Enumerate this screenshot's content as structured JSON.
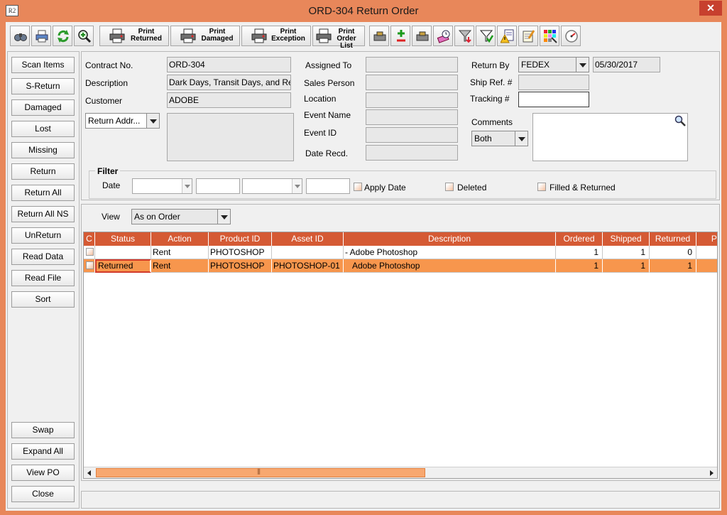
{
  "window": {
    "title": "ORD-304 Return Order",
    "app_icon_label": "R2",
    "close_symbol": "✕",
    "accent_color": "#e8875a"
  },
  "toolbar": {
    "print_returned": [
      "Print",
      "Returned"
    ],
    "print_damaged": [
      "Print",
      "Damaged"
    ],
    "print_exception": [
      "Print",
      "Exception"
    ],
    "print_order_list": [
      "Print",
      "Order List"
    ]
  },
  "left_buttons": {
    "scan_items": "Scan Items",
    "s_return": "S-Return",
    "damaged": "Damaged",
    "lost": "Lost",
    "missing": "Missing",
    "return": "Return",
    "return_all": "Return All",
    "return_all_ns": "Return All NS",
    "unreturn": "UnReturn",
    "read_data": "Read Data",
    "read_file": "Read File",
    "sort": "Sort",
    "swap": "Swap",
    "expand_all": "Expand All",
    "view_po": "View PO",
    "close": "Close"
  },
  "header": {
    "contract_no_label": "Contract No.",
    "contract_no": "ORD-304",
    "description_label": "Description",
    "description": "Dark Days, Transit Days, and Re",
    "customer_label": "Customer",
    "customer": "ADOBE",
    "address_select": "Return Addr...",
    "assigned_to_label": "Assigned To",
    "sales_person_label": "Sales Person",
    "location_label": "Location",
    "event_name_label": "Event Name",
    "event_id_label": "Event ID",
    "date_recd_label": "Date Recd.",
    "return_by_label": "Return By",
    "return_by": "FEDEX",
    "return_date": "05/30/2017",
    "ship_ref_label": "Ship Ref. #",
    "tracking_label": "Tracking #",
    "comments_label": "Comments",
    "comments_select": "Both"
  },
  "filter": {
    "title": "Filter",
    "date_label": "Date",
    "apply_date": "Apply Date",
    "deleted": "Deleted",
    "filled_returned": "Filled & Returned"
  },
  "view": {
    "label": "View",
    "selected": "As on Order"
  },
  "grid": {
    "columns": [
      "C",
      "Status",
      "Action",
      "Product ID",
      "Asset ID",
      "Description",
      "Ordered",
      "Shipped",
      "Returned",
      "PO"
    ],
    "rows": [
      {
        "status": "",
        "action": "Rent",
        "product_id": "PHOTOSHOP",
        "asset_id": "",
        "description": "- Adobe Photoshop",
        "ordered": "1",
        "shipped": "1",
        "returned": "0"
      },
      {
        "status": "Returned",
        "action": "Rent",
        "product_id": "PHOTOSHOP",
        "asset_id": "PHOTOSHOP-01",
        "description": "Adobe Photoshop",
        "ordered": "1",
        "shipped": "1",
        "returned": "1"
      }
    ],
    "header_color": "#d55a34",
    "selected_row_color": "#f7964d"
  }
}
